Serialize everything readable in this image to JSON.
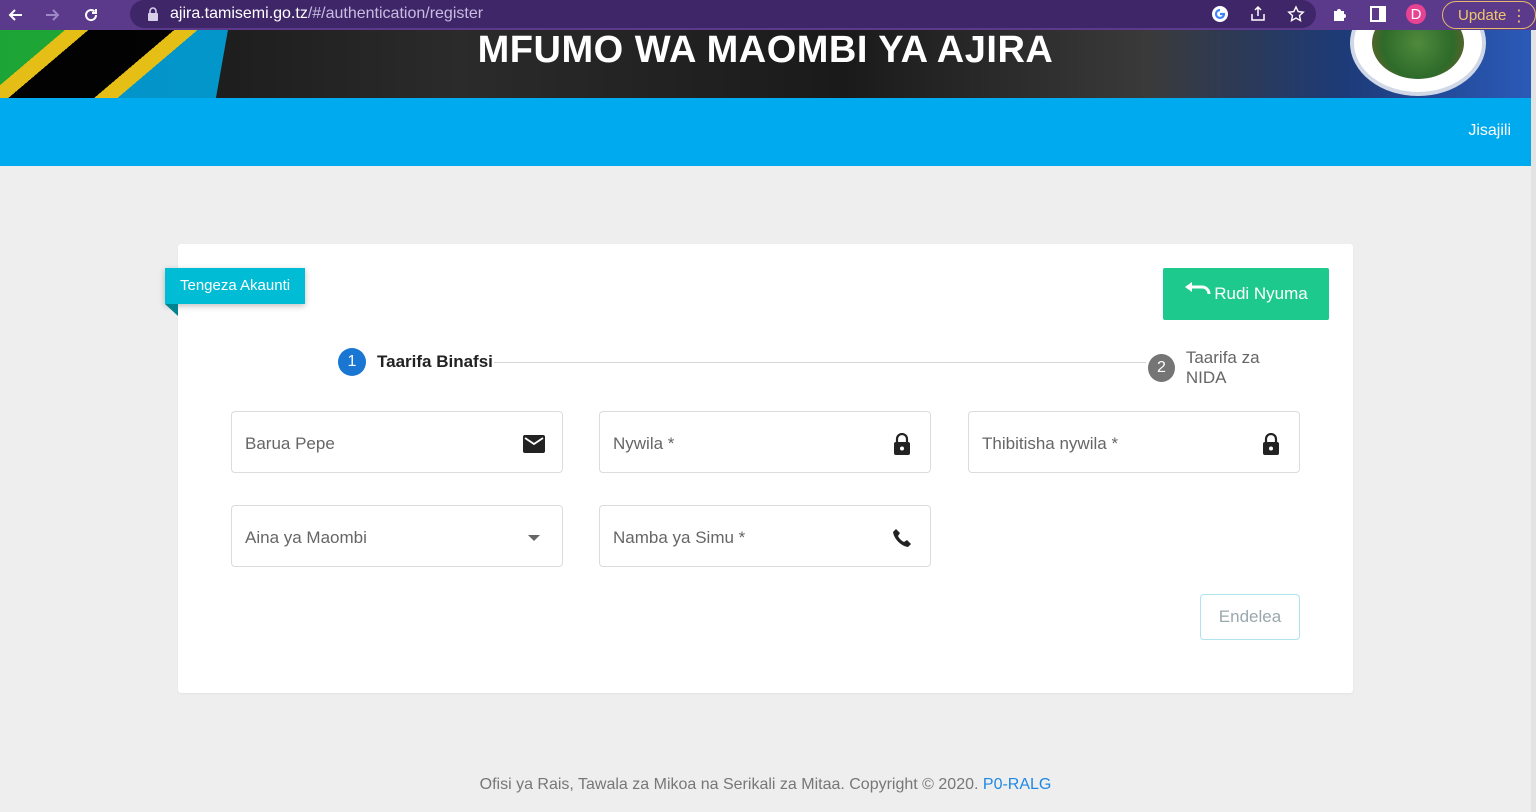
{
  "browser": {
    "url_host": "ajira.tamisemi.go.tz",
    "url_path": "/#/authentication/register",
    "profile_initial": "D",
    "update_label": "Update"
  },
  "banner": {
    "title": "MFUMO WA MAOMBI YA AJIRA"
  },
  "navbar": {
    "link": "Jisajili"
  },
  "card": {
    "ribbon": "Tengeza Akaunti",
    "back_button": "Rudi Nyuma",
    "steps": [
      {
        "number": "1",
        "label": "Taarifa Binafsi"
      },
      {
        "number": "2",
        "label": "Taarifa za NIDA"
      }
    ],
    "fields": {
      "email": "Barua Pepe",
      "password": "Nywila *",
      "confirm_password": "Thibitisha nywila *",
      "application_type": "Aina ya Maombi",
      "phone": "Namba ya Simu *"
    },
    "next_button": "Endelea"
  },
  "footer": {
    "text": "Ofisi ya Rais, Tawala za Mikoa na Serikali za Mitaa. Copyright © 2020. ",
    "link": "P0-RALG"
  },
  "colors": {
    "chrome": "#5b3a8c",
    "navbar": "#00aaee",
    "ribbon": "#00bcd4",
    "back_button": "#1dc98c",
    "step_active": "#1976d2"
  }
}
